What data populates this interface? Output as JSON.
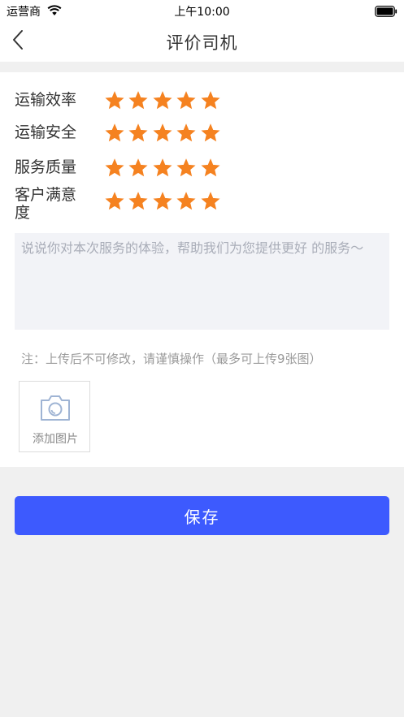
{
  "status_bar": {
    "carrier": "运营商",
    "time": "上午10:00"
  },
  "header": {
    "title": "评价司机",
    "back_icon": "chevron-left-icon"
  },
  "ratings": [
    {
      "label": "运输效率",
      "value": 5,
      "max": 5
    },
    {
      "label": "运输安全",
      "value": 5,
      "max": 5
    },
    {
      "label": "服务质量",
      "value": 5,
      "max": 5
    },
    {
      "label": "客户满意度",
      "value": 5,
      "max": 5
    }
  ],
  "review": {
    "value": "",
    "placeholder": "说说你对本次服务的体验，帮助我们为您提供更好 的服务～"
  },
  "note": "注：上传后不可修改，请谨慎操作（最多可上传9张图）",
  "upload": {
    "label": "添加图片",
    "icon": "camera-icon"
  },
  "save_label": "保存",
  "colors": {
    "accent": "#3d5afe",
    "star": "#f58220",
    "background": "#f0f0f0"
  }
}
